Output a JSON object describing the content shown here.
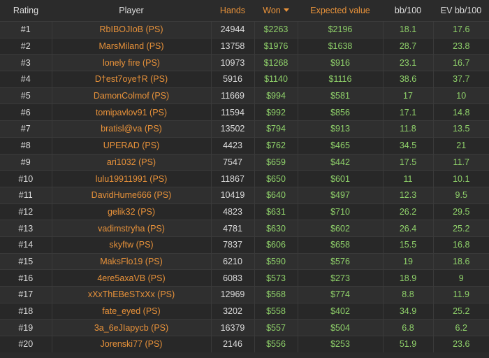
{
  "headers": {
    "rating": "Rating",
    "player": "Player",
    "hands": "Hands",
    "won": "Won",
    "expected": "Expected value",
    "bb100": "bb/100",
    "ev_bb100": "EV bb/100"
  },
  "colors": {
    "background": "#2b2b2b",
    "accent_orange": "#e8923a",
    "value_green": "#8fd16a"
  },
  "sort": {
    "column": "won",
    "direction": "desc",
    "icon": "caret-down-icon"
  },
  "rows": [
    {
      "rank": "#1",
      "player": "RbIBOJIoB (PS)",
      "hands": "24944",
      "won": "$2263",
      "expected": "$2196",
      "bb100": "18.1",
      "ev_bb100": "17.6"
    },
    {
      "rank": "#2",
      "player": "MarsMiland (PS)",
      "hands": "13758",
      "won": "$1976",
      "expected": "$1638",
      "bb100": "28.7",
      "ev_bb100": "23.8"
    },
    {
      "rank": "#3",
      "player": "lonely fire (PS)",
      "hands": "10973",
      "won": "$1268",
      "expected": "$916",
      "bb100": "23.1",
      "ev_bb100": "16.7"
    },
    {
      "rank": "#4",
      "player": "D†est7oye†R (PS)",
      "hands": "5916",
      "won": "$1140",
      "expected": "$1116",
      "bb100": "38.6",
      "ev_bb100": "37.7"
    },
    {
      "rank": "#5",
      "player": "DamonColmof (PS)",
      "hands": "11669",
      "won": "$994",
      "expected": "$581",
      "bb100": "17",
      "ev_bb100": "10"
    },
    {
      "rank": "#6",
      "player": "tomipavlov91 (PS)",
      "hands": "11594",
      "won": "$992",
      "expected": "$856",
      "bb100": "17.1",
      "ev_bb100": "14.8"
    },
    {
      "rank": "#7",
      "player": "bratisl@va (PS)",
      "hands": "13502",
      "won": "$794",
      "expected": "$913",
      "bb100": "11.8",
      "ev_bb100": "13.5"
    },
    {
      "rank": "#8",
      "player": "UPERAD (PS)",
      "hands": "4423",
      "won": "$762",
      "expected": "$465",
      "bb100": "34.5",
      "ev_bb100": "21"
    },
    {
      "rank": "#9",
      "player": "ari1032 (PS)",
      "hands": "7547",
      "won": "$659",
      "expected": "$442",
      "bb100": "17.5",
      "ev_bb100": "11.7"
    },
    {
      "rank": "#10",
      "player": "lulu19911991 (PS)",
      "hands": "11867",
      "won": "$650",
      "expected": "$601",
      "bb100": "11",
      "ev_bb100": "10.1"
    },
    {
      "rank": "#11",
      "player": "DavidHume666 (PS)",
      "hands": "10419",
      "won": "$640",
      "expected": "$497",
      "bb100": "12.3",
      "ev_bb100": "9.5"
    },
    {
      "rank": "#12",
      "player": "gelik32 (PS)",
      "hands": "4823",
      "won": "$631",
      "expected": "$710",
      "bb100": "26.2",
      "ev_bb100": "29.5"
    },
    {
      "rank": "#13",
      "player": "vadimstryha (PS)",
      "hands": "4781",
      "won": "$630",
      "expected": "$602",
      "bb100": "26.4",
      "ev_bb100": "25.2"
    },
    {
      "rank": "#14",
      "player": "skyftw (PS)",
      "hands": "7837",
      "won": "$606",
      "expected": "$658",
      "bb100": "15.5",
      "ev_bb100": "16.8"
    },
    {
      "rank": "#15",
      "player": "MaksFlo19 (PS)",
      "hands": "6210",
      "won": "$590",
      "expected": "$576",
      "bb100": "19",
      "ev_bb100": "18.6"
    },
    {
      "rank": "#16",
      "player": "4ere5axaVB (PS)",
      "hands": "6083",
      "won": "$573",
      "expected": "$273",
      "bb100": "18.9",
      "ev_bb100": "9"
    },
    {
      "rank": "#17",
      "player": "xXxThEBeSTxXx (PS)",
      "hands": "12969",
      "won": "$568",
      "expected": "$774",
      "bb100": "8.8",
      "ev_bb100": "11.9"
    },
    {
      "rank": "#18",
      "player": "fate_eyed (PS)",
      "hands": "3202",
      "won": "$558",
      "expected": "$402",
      "bb100": "34.9",
      "ev_bb100": "25.2"
    },
    {
      "rank": "#19",
      "player": "3a_6eJIapycb (PS)",
      "hands": "16379",
      "won": "$557",
      "expected": "$504",
      "bb100": "6.8",
      "ev_bb100": "6.2"
    },
    {
      "rank": "#20",
      "player": "Jorenski77 (PS)",
      "hands": "2146",
      "won": "$556",
      "expected": "$253",
      "bb100": "51.9",
      "ev_bb100": "23.6"
    }
  ]
}
